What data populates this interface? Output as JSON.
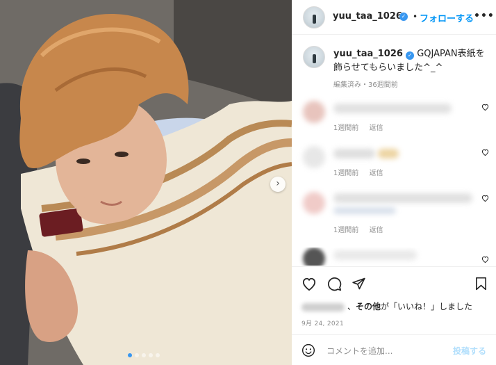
{
  "post": {
    "username": "yuu_taa_1026",
    "verified_icon": "verified-badge-icon",
    "separator": "•",
    "follow_label": "フォローする",
    "more_label": "•••",
    "caption": "GQJAPAN表紙を飾らせてもらいました^_^",
    "caption_meta": "編集済み・36週間前",
    "carousel_next_label": "›",
    "carousel_dots": 5,
    "carousel_active_index": 0
  },
  "comments": [
    {
      "time": "1週間前",
      "reply": "返信",
      "avatar_color": "#e8c4bd",
      "blur_color": "#d9d9d9",
      "blur2_color": "#cfcfcf"
    },
    {
      "time": "1週間前",
      "reply": "返信",
      "avatar_color": "#e7e7e7",
      "blur_color": "#d6d6d6",
      "blur2_color": "#e8c98a"
    },
    {
      "time": "1週間前",
      "reply": "返信",
      "avatar_color": "#f0cbc8",
      "blur_color": "#d8d8d8",
      "blur2_color": "#cdd7e5"
    },
    {
      "time": "",
      "reply": "",
      "avatar_color": "#555555",
      "blur_color": "#e3e3e3",
      "blur2_color": "#e3e3e3"
    }
  ],
  "actions": {
    "like_icon": "heart-icon",
    "comment_icon": "comment-bubble-icon",
    "share_icon": "paper-plane-icon",
    "save_icon": "bookmark-icon"
  },
  "likes": {
    "others_label": "その他",
    "suffix": "が「いいね！」しました"
  },
  "date": "9月 24, 2021",
  "comment_bar": {
    "emoji_icon": "smiley-icon",
    "placeholder": "コメントを追加...",
    "post_label": "投稿する"
  },
  "colors": {
    "accent": "#0095f6",
    "verified": "#3897f0",
    "muted": "#8e8e8e",
    "post_disabled": "#b2dffc"
  }
}
